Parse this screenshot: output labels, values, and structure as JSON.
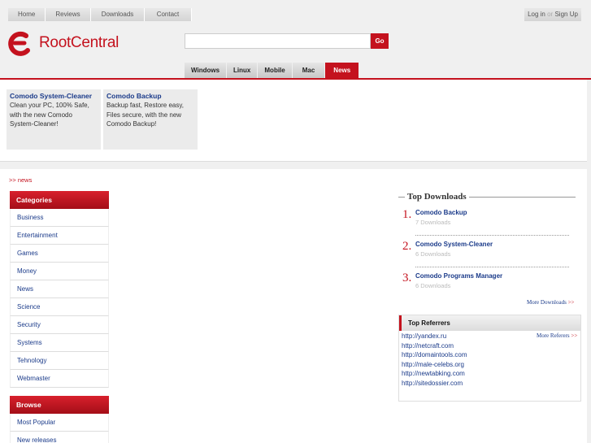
{
  "topnav": [
    "Home",
    "Reviews",
    "Downloads",
    "Contact"
  ],
  "auth": {
    "login": "Log in",
    "or": "or",
    "signup": "Sign Up"
  },
  "brand": {
    "name": "RootCentral",
    "color": "#c4121e"
  },
  "search": {
    "value": "",
    "go_label": "Go"
  },
  "ostabs": [
    "Windows",
    "Linux",
    "Mobile",
    "Mac",
    "News"
  ],
  "promos": [
    {
      "title": "Comodo System-Cleaner",
      "desc": "Clean your PC, 100% Safe, with the new Comodo System-Cleaner!"
    },
    {
      "title": "Comodo Backup",
      "desc": "Backup fast, Restore easy, Files secure, with the new Comodo Backup!"
    }
  ],
  "breadcrumb": ">> news",
  "categories": {
    "title": "Categories",
    "items": [
      "Business",
      "Entertainment",
      "Games",
      "Money",
      "News",
      "Science",
      "Security",
      "Systems",
      "Tehnology",
      "Webmaster"
    ]
  },
  "browse": {
    "title": "Browse",
    "items": [
      "Most Popular",
      "New releases"
    ]
  },
  "top_downloads": {
    "title": "Top Downloads",
    "items": [
      {
        "rank": "1.",
        "name": "Comodo Backup",
        "count": "7 Downloads"
      },
      {
        "rank": "2.",
        "name": "Comodo System-Cleaner",
        "count": "6 Downloads"
      },
      {
        "rank": "3.",
        "name": "Comodo Programs Manager",
        "count": "6 Downloads"
      }
    ],
    "more": "More Downloads",
    "more_arrow": ">>"
  },
  "top_referrers": {
    "title": "Top Referrers",
    "more": "More Referers",
    "more_arrow": ">>",
    "items": [
      "http://yandex.ru",
      "http://netcraft.com",
      "http://domaintools.com",
      "http://male-celebs.org",
      "http://newtabking.com",
      "http://sitedossier.com"
    ]
  }
}
